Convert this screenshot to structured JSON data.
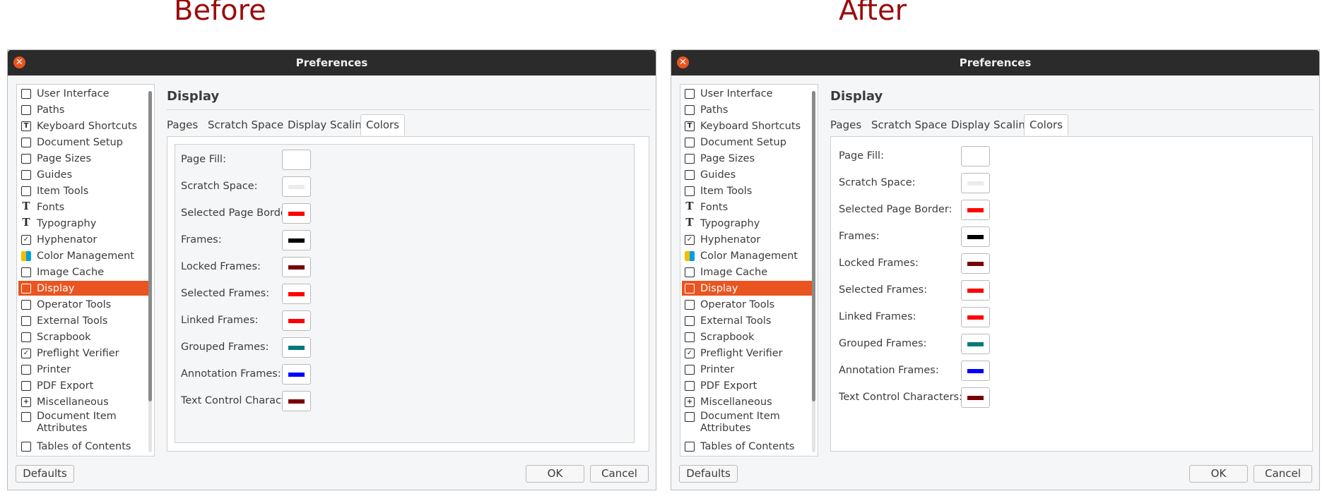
{
  "captions": {
    "before": "Before",
    "after": "After"
  },
  "window": {
    "title": "Preferences"
  },
  "sidebar": {
    "items": [
      {
        "label": "User Interface",
        "icon": "user-icon"
      },
      {
        "label": "Paths",
        "icon": "folder-icon"
      },
      {
        "label": "Keyboard Shortcuts",
        "icon": "keyboard-icon"
      },
      {
        "label": "Document Setup",
        "icon": "document-icon"
      },
      {
        "label": "Page Sizes",
        "icon": "page-size-icon"
      },
      {
        "label": "Guides",
        "icon": "guides-icon"
      },
      {
        "label": "Item Tools",
        "icon": "wrench-icon"
      },
      {
        "label": "Fonts",
        "icon": "font-icon"
      },
      {
        "label": "Typography",
        "icon": "typography-icon"
      },
      {
        "label": "Hyphenator",
        "icon": "checkbox-icon"
      },
      {
        "label": "Color Management",
        "icon": "color-icon"
      },
      {
        "label": "Image Cache",
        "icon": "image-icon"
      },
      {
        "label": "Display",
        "icon": "monitor-icon"
      },
      {
        "label": "Operator Tools",
        "icon": "wrench-icon"
      },
      {
        "label": "External Tools",
        "icon": "gear-icon"
      },
      {
        "label": "Scrapbook",
        "icon": "scrapbook-icon"
      },
      {
        "label": "Preflight Verifier",
        "icon": "checkbox-icon"
      },
      {
        "label": "Printer",
        "icon": "printer-icon"
      },
      {
        "label": "PDF Export",
        "icon": "pdf-icon"
      },
      {
        "label": "Miscellaneous",
        "icon": "plus-box-icon"
      },
      {
        "label": "Document Item Attributes",
        "icon": "table-icon"
      },
      {
        "label": "Tables of Contents",
        "icon": "list-icon"
      }
    ],
    "selected": "Display"
  },
  "main": {
    "title": "Display",
    "tabs": [
      "Pages",
      "Scratch Space",
      "Display Scaling",
      "Colors"
    ],
    "active_tab": "Colors"
  },
  "color_rows": [
    {
      "label": "Page Fill:",
      "color": null
    },
    {
      "label": "Scratch Space:",
      "color": "#ececec"
    },
    {
      "label": "Selected Page Border:",
      "color": "#ff0000"
    },
    {
      "label": "Frames:",
      "color": "#000000"
    },
    {
      "label": "Locked Frames:",
      "color": "#7a0000"
    },
    {
      "label": "Selected Frames:",
      "color": "#ff0000"
    },
    {
      "label": "Linked Frames:",
      "color": "#ff0000"
    },
    {
      "label": "Grouped Frames:",
      "color": "#007a7a"
    },
    {
      "label": "Annotation Frames:",
      "color": "#0000ff"
    },
    {
      "label": "Text Control Characters:",
      "color": "#7a0000"
    }
  ],
  "buttons": {
    "defaults": "Defaults",
    "ok": "OK",
    "cancel": "Cancel"
  }
}
